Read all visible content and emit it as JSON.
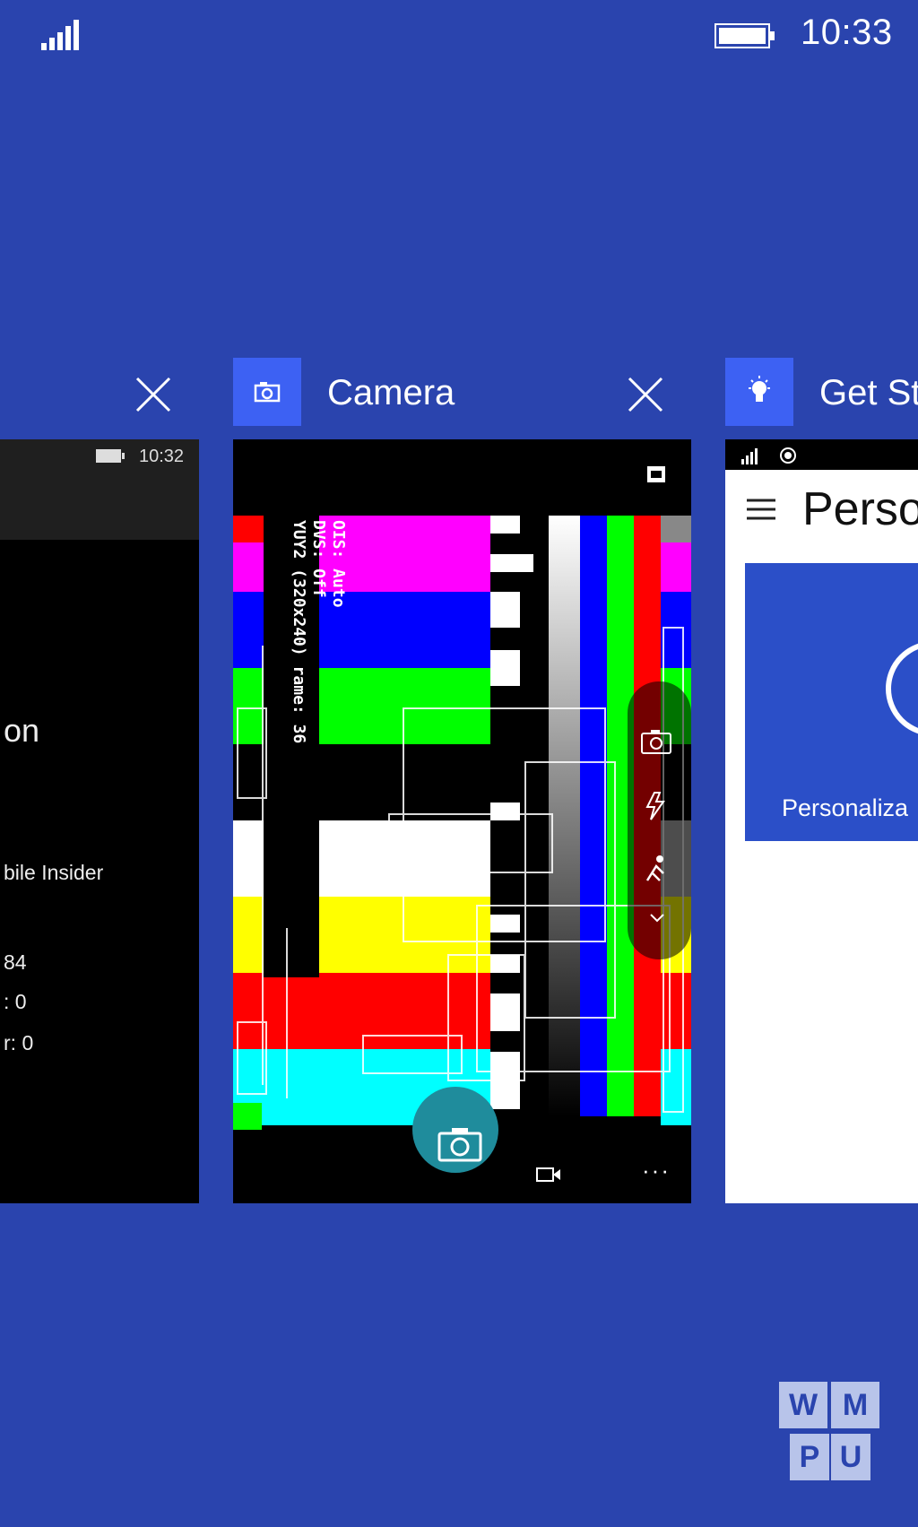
{
  "status_bar": {
    "time": "10:33"
  },
  "cards": [
    {
      "id": "settings",
      "screen": {
        "time": "10:32",
        "lines": [
          "on",
          "bile Insider",
          "84",
          ": 0",
          "r: 0"
        ]
      }
    },
    {
      "id": "camera",
      "title": "Camera",
      "screen": {
        "debug_lines": [
          "OIS: Auto",
          "DVS: Off",
          "YUY2 (320x240) rame: 36"
        ]
      }
    },
    {
      "id": "get-started",
      "title": "Get Sta",
      "screen": {
        "title": "Persor",
        "tile_label": "Personaliza"
      }
    }
  ],
  "watermark": {
    "letters": [
      "W",
      "M",
      "P",
      "U"
    ]
  },
  "colors": {
    "background": "#2a44ae",
    "app_tile": "#3d61f3",
    "hero_tile": "#2b4fc8"
  }
}
